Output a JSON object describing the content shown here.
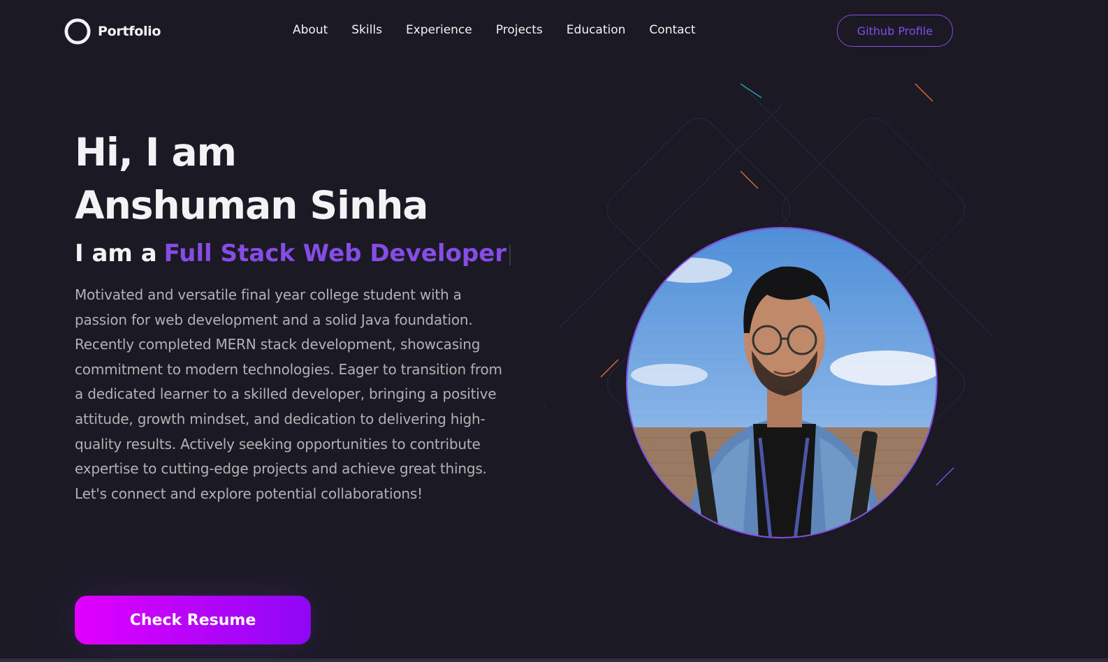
{
  "brand": {
    "name": "Portfolio"
  },
  "nav": {
    "links": [
      "About",
      "Skills",
      "Experience",
      "Projects",
      "Education",
      "Contact"
    ],
    "github_label": "Github Profile"
  },
  "hero": {
    "greeting": "Hi, I am",
    "name": "Anshuman Sinha",
    "role_prefix": "I am a",
    "role": "Full Stack Web Developer",
    "description": "Motivated and versatile final year college student with a passion for web development and a solid Java foundation. Recently completed MERN stack development, showcasing commitment to modern technologies. Eager to transition from a dedicated learner to a skilled developer, bringing a positive attitude, growth mindset, and dedication to delivering high-quality results. Actively seeking opportunities to contribute expertise to cutting-edge projects and achieve great things. Let's connect and explore potential collaborations!",
    "cta_label": "Check Resume"
  },
  "colors": {
    "background": "#1b1a24",
    "accent": "#854ce6",
    "text_primary": "#f2f3f4",
    "text_secondary": "#b1b2b3",
    "cta_gradient_start": "#e100ff",
    "cta_gradient_end": "#8e07f5"
  }
}
